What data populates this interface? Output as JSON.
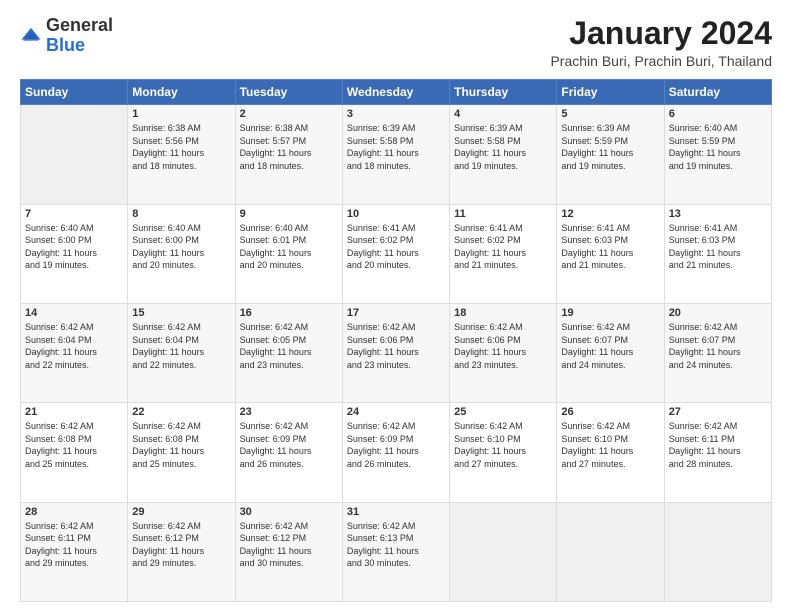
{
  "header": {
    "logo_general": "General",
    "logo_blue": "Blue",
    "title": "January 2024",
    "subtitle": "Prachin Buri, Prachin Buri, Thailand"
  },
  "calendar": {
    "days_of_week": [
      "Sunday",
      "Monday",
      "Tuesday",
      "Wednesday",
      "Thursday",
      "Friday",
      "Saturday"
    ],
    "weeks": [
      [
        {
          "day": "",
          "info": ""
        },
        {
          "day": "1",
          "info": "Sunrise: 6:38 AM\nSunset: 5:56 PM\nDaylight: 11 hours\nand 18 minutes."
        },
        {
          "day": "2",
          "info": "Sunrise: 6:38 AM\nSunset: 5:57 PM\nDaylight: 11 hours\nand 18 minutes."
        },
        {
          "day": "3",
          "info": "Sunrise: 6:39 AM\nSunset: 5:58 PM\nDaylight: 11 hours\nand 18 minutes."
        },
        {
          "day": "4",
          "info": "Sunrise: 6:39 AM\nSunset: 5:58 PM\nDaylight: 11 hours\nand 19 minutes."
        },
        {
          "day": "5",
          "info": "Sunrise: 6:39 AM\nSunset: 5:59 PM\nDaylight: 11 hours\nand 19 minutes."
        },
        {
          "day": "6",
          "info": "Sunrise: 6:40 AM\nSunset: 5:59 PM\nDaylight: 11 hours\nand 19 minutes."
        }
      ],
      [
        {
          "day": "7",
          "info": "Sunrise: 6:40 AM\nSunset: 6:00 PM\nDaylight: 11 hours\nand 19 minutes."
        },
        {
          "day": "8",
          "info": "Sunrise: 6:40 AM\nSunset: 6:00 PM\nDaylight: 11 hours\nand 20 minutes."
        },
        {
          "day": "9",
          "info": "Sunrise: 6:40 AM\nSunset: 6:01 PM\nDaylight: 11 hours\nand 20 minutes."
        },
        {
          "day": "10",
          "info": "Sunrise: 6:41 AM\nSunset: 6:02 PM\nDaylight: 11 hours\nand 20 minutes."
        },
        {
          "day": "11",
          "info": "Sunrise: 6:41 AM\nSunset: 6:02 PM\nDaylight: 11 hours\nand 21 minutes."
        },
        {
          "day": "12",
          "info": "Sunrise: 6:41 AM\nSunset: 6:03 PM\nDaylight: 11 hours\nand 21 minutes."
        },
        {
          "day": "13",
          "info": "Sunrise: 6:41 AM\nSunset: 6:03 PM\nDaylight: 11 hours\nand 21 minutes."
        }
      ],
      [
        {
          "day": "14",
          "info": "Sunrise: 6:42 AM\nSunset: 6:04 PM\nDaylight: 11 hours\nand 22 minutes."
        },
        {
          "day": "15",
          "info": "Sunrise: 6:42 AM\nSunset: 6:04 PM\nDaylight: 11 hours\nand 22 minutes."
        },
        {
          "day": "16",
          "info": "Sunrise: 6:42 AM\nSunset: 6:05 PM\nDaylight: 11 hours\nand 23 minutes."
        },
        {
          "day": "17",
          "info": "Sunrise: 6:42 AM\nSunset: 6:06 PM\nDaylight: 11 hours\nand 23 minutes."
        },
        {
          "day": "18",
          "info": "Sunrise: 6:42 AM\nSunset: 6:06 PM\nDaylight: 11 hours\nand 23 minutes."
        },
        {
          "day": "19",
          "info": "Sunrise: 6:42 AM\nSunset: 6:07 PM\nDaylight: 11 hours\nand 24 minutes."
        },
        {
          "day": "20",
          "info": "Sunrise: 6:42 AM\nSunset: 6:07 PM\nDaylight: 11 hours\nand 24 minutes."
        }
      ],
      [
        {
          "day": "21",
          "info": "Sunrise: 6:42 AM\nSunset: 6:08 PM\nDaylight: 11 hours\nand 25 minutes."
        },
        {
          "day": "22",
          "info": "Sunrise: 6:42 AM\nSunset: 6:08 PM\nDaylight: 11 hours\nand 25 minutes."
        },
        {
          "day": "23",
          "info": "Sunrise: 6:42 AM\nSunset: 6:09 PM\nDaylight: 11 hours\nand 26 minutes."
        },
        {
          "day": "24",
          "info": "Sunrise: 6:42 AM\nSunset: 6:09 PM\nDaylight: 11 hours\nand 26 minutes."
        },
        {
          "day": "25",
          "info": "Sunrise: 6:42 AM\nSunset: 6:10 PM\nDaylight: 11 hours\nand 27 minutes."
        },
        {
          "day": "26",
          "info": "Sunrise: 6:42 AM\nSunset: 6:10 PM\nDaylight: 11 hours\nand 27 minutes."
        },
        {
          "day": "27",
          "info": "Sunrise: 6:42 AM\nSunset: 6:11 PM\nDaylight: 11 hours\nand 28 minutes."
        }
      ],
      [
        {
          "day": "28",
          "info": "Sunrise: 6:42 AM\nSunset: 6:11 PM\nDaylight: 11 hours\nand 29 minutes."
        },
        {
          "day": "29",
          "info": "Sunrise: 6:42 AM\nSunset: 6:12 PM\nDaylight: 11 hours\nand 29 minutes."
        },
        {
          "day": "30",
          "info": "Sunrise: 6:42 AM\nSunset: 6:12 PM\nDaylight: 11 hours\nand 30 minutes."
        },
        {
          "day": "31",
          "info": "Sunrise: 6:42 AM\nSunset: 6:13 PM\nDaylight: 11 hours\nand 30 minutes."
        },
        {
          "day": "",
          "info": ""
        },
        {
          "day": "",
          "info": ""
        },
        {
          "day": "",
          "info": ""
        }
      ]
    ]
  }
}
